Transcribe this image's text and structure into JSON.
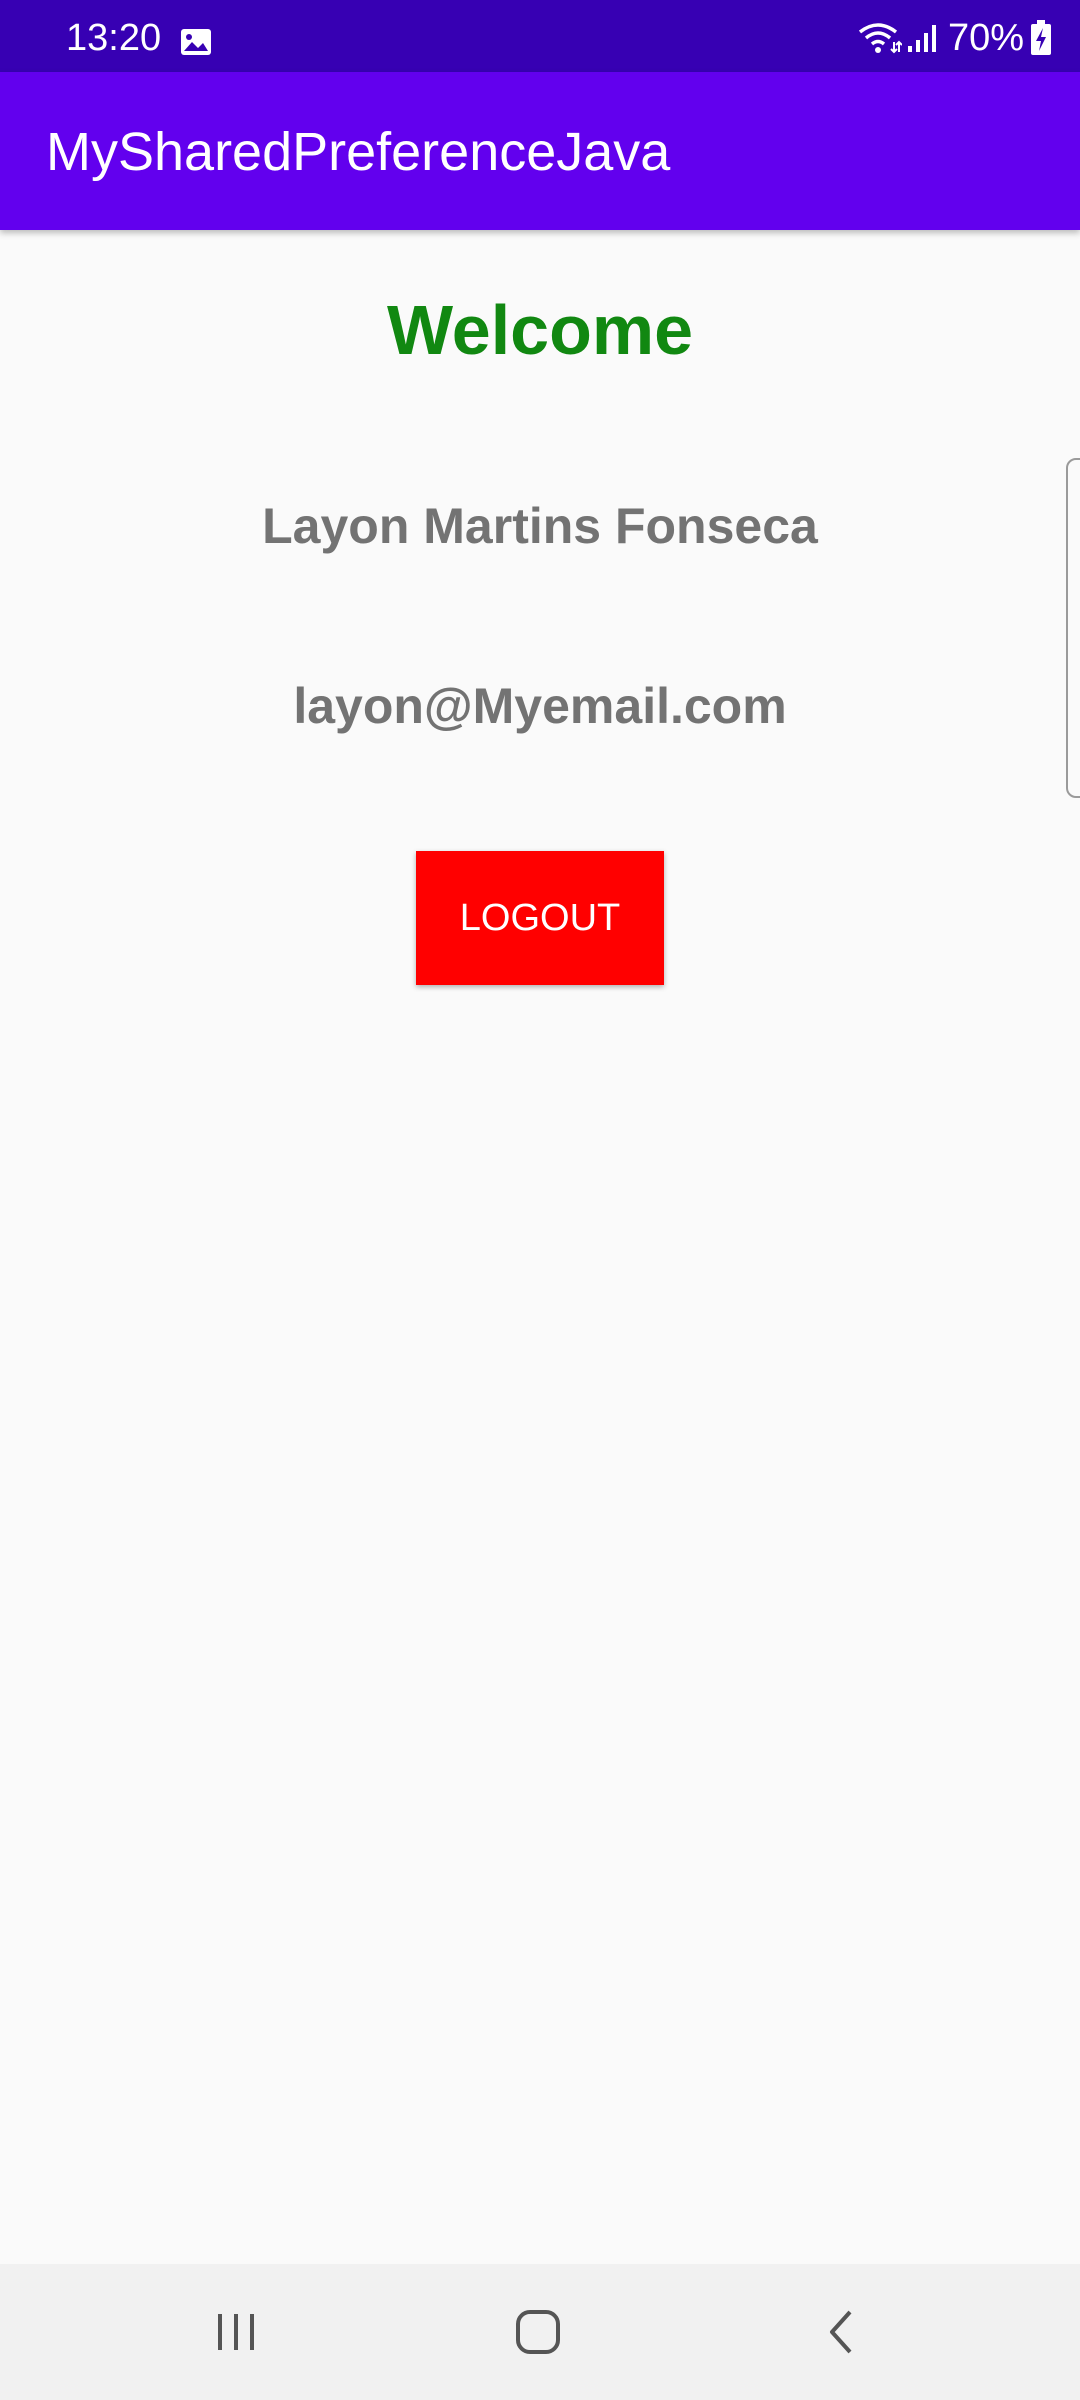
{
  "status_bar": {
    "time": "13:20",
    "battery_percent": "70%",
    "icons": [
      "image-icon",
      "wifi-icon",
      "signal-icon",
      "battery-charging-icon"
    ]
  },
  "app_bar": {
    "title": "MySharedPreferenceJava"
  },
  "main": {
    "welcome": "Welcome",
    "name": "Layon Martins Fonseca",
    "email": "layon@Myemail.com",
    "logout_label": "LOGOUT"
  },
  "nav_bar": {
    "icons": [
      "recents-icon",
      "home-icon",
      "back-icon"
    ]
  },
  "colors": {
    "status_bar": "#3700b3",
    "app_bar": "#6200ee",
    "welcome_text": "#118811",
    "info_text": "#737373",
    "logout_button": "#ff0000",
    "background": "#fafafa"
  }
}
